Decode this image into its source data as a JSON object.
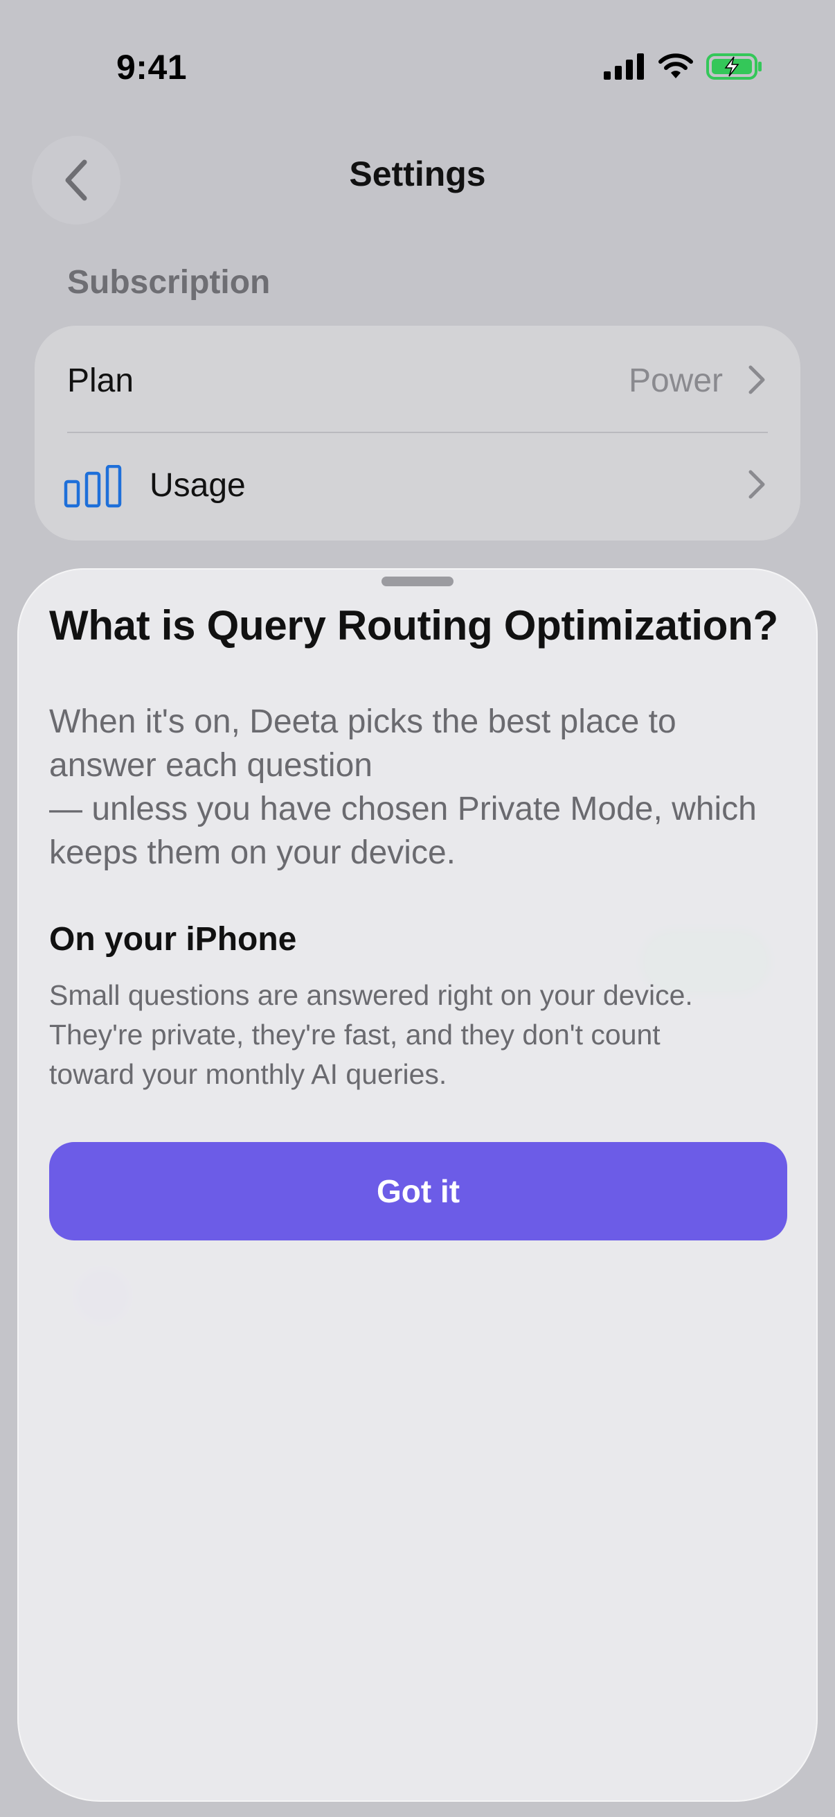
{
  "status_bar": {
    "time": "9:41",
    "icons": [
      "cellular-signal-icon",
      "wifi-icon",
      "battery-charging-icon"
    ],
    "battery_color": "#34c759"
  },
  "header": {
    "title": "Settings",
    "back_icon": "chevron-left-icon"
  },
  "subscription": {
    "section_title": "Subscription",
    "rows": [
      {
        "label": "Plan",
        "value": "Power",
        "icon": "chevron-right-icon"
      },
      {
        "label": "Usage",
        "icon": "bar-chart-icon",
        "icon_color": "#1e6fd9"
      }
    ]
  },
  "sheet": {
    "title": "What is Query Routing Optimization?",
    "intro_lines": [
      "When it's on, Deeta picks the best place to",
      "answer each question",
      "— unless you have chosen Private Mode, which",
      "keeps them on your device."
    ],
    "subsection_title": "On your iPhone",
    "subsection_lines": [
      "Small questions are answered right on your device.",
      "They're private, they're fast, and they don't count",
      "toward your monthly AI queries."
    ],
    "primary_button": "Got it",
    "accent": "#6c5ce7"
  }
}
